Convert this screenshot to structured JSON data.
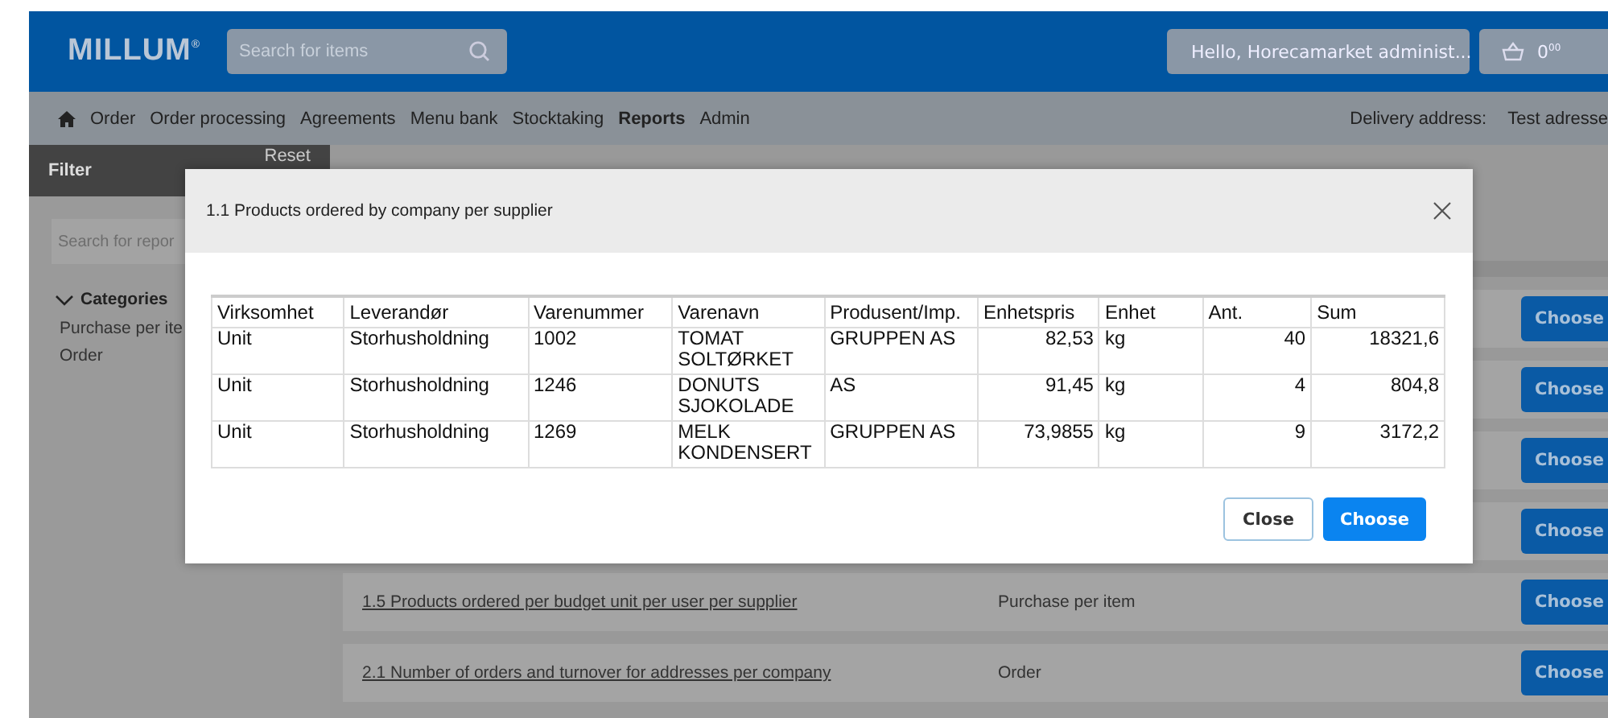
{
  "header": {
    "logo": "MILLUM$^{®}$",
    "search": {
      "placeholder": "Search for items"
    },
    "user_menu": "Hello, Horecamarket administ...",
    "cart": "0$^{00}$"
  },
  "nav": {
    "items": [
      {
        "label": "Order",
        "selected": false
      },
      {
        "label": "Order processing",
        "selected": false
      },
      {
        "label": "Agreements",
        "selected": false
      },
      {
        "label": "Menu bank",
        "selected": false
      },
      {
        "label": "Stocktaking",
        "selected": false
      },
      {
        "label": "Reports",
        "selected": true
      },
      {
        "label": "Admin",
        "selected": false
      }
    ],
    "delivery_label": "Delivery address:",
    "delivery_value": "Test adresse"
  },
  "sidebar": {
    "title": "Filter",
    "reset": "Reset",
    "search": {
      "placeholder": "Search for repor"
    },
    "categories_label": "Categories",
    "categories": [
      "Purchase per ite",
      "Order"
    ]
  },
  "reports": [
    {
      "button": "Choose"
    },
    {
      "button": "Choose"
    },
    {
      "button": "Choose"
    },
    {
      "button": "Choose"
    },
    {
      "title": "1.5 Products ordered per budget unit per user per supplier",
      "category": "Purchase per item",
      "button": "Choose"
    },
    {
      "title": "2.1 Number of orders and turnover for addresses per company",
      "category": "Order",
      "button": "Choose"
    }
  ],
  "modal": {
    "title": "1.1 Products ordered by company per supplier",
    "table": {
      "columns": [
        {
          "label": "Virksomhet"
        },
        {
          "label": "Leverandør"
        },
        {
          "label": "Varenummer"
        },
        {
          "label": "Varenavn"
        },
        {
          "label": "Produsent/Imp."
        },
        {
          "label": "Enhetspris"
        },
        {
          "label": "Enhet"
        },
        {
          "label": "Ant."
        },
        {
          "label": "Sum"
        }
      ],
      "rows": [
        [
          "Unit",
          "Storhusholdning",
          "1002",
          "TOMAT SOLTØRKET",
          "GRUPPEN AS",
          "82,53",
          "kg",
          "40",
          "18321,6"
        ],
        [
          "Unit",
          "Storhusholdning",
          "1246",
          "DONUTS SJOKOLADE",
          "AS",
          "91,45",
          "kg",
          "4",
          "804,8"
        ],
        [
          "Unit",
          "Storhusholdning",
          "1269",
          "MELK KONDENSERT",
          "GRUPPEN AS",
          "73,9855",
          "kg",
          "9",
          "3172,2"
        ]
      ]
    },
    "buttons": [
      {
        "label": "Close",
        "kind": "secondary"
      },
      {
        "label": "Choose",
        "kind": "primary"
      }
    ]
  }
}
